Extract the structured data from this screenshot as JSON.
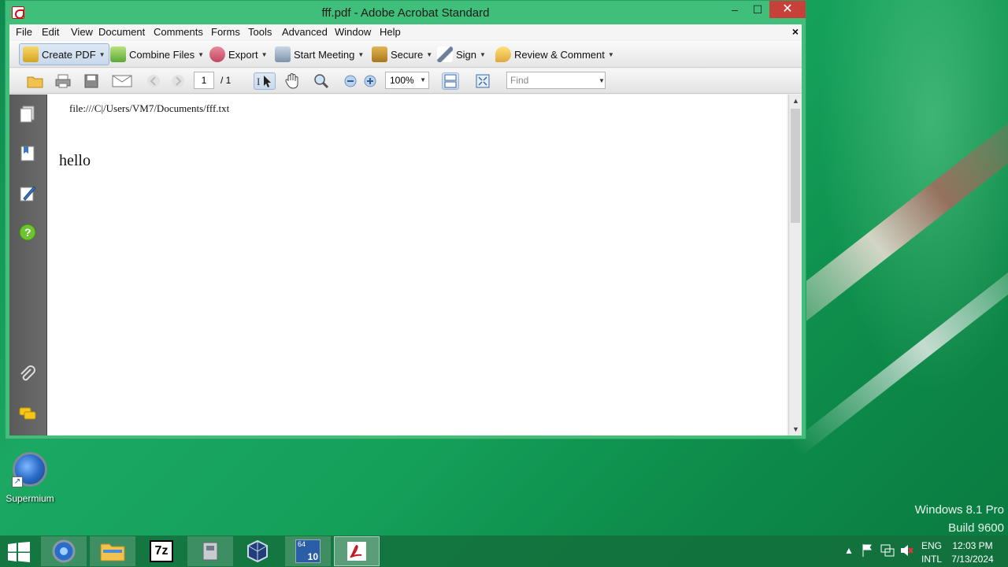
{
  "window": {
    "title": "fff.pdf - Adobe Acrobat Standard",
    "minimize_glyph": "‒",
    "maximize_glyph": "☐",
    "close_glyph": "✕"
  },
  "menubar": {
    "items": [
      "File",
      "Edit",
      "View",
      "Document",
      "Comments",
      "Forms",
      "Tools",
      "Advanced",
      "Window",
      "Help"
    ],
    "close_glyph": "×"
  },
  "toolbar1": {
    "create_pdf": "Create PDF",
    "combine_files": "Combine Files",
    "export": "Export",
    "start_meeting": "Start Meeting",
    "secure": "Secure",
    "sign": "Sign",
    "review_comment": "Review & Comment"
  },
  "toolbar2": {
    "page_current": "1",
    "page_total": "/ 1",
    "zoom": "100%",
    "find_placeholder": "Find"
  },
  "document": {
    "path_text": "file:///C|/Users/VM7/Documents/fff.txt",
    "body_text": "hello"
  },
  "desktop": {
    "icon_label": "Supermium",
    "watermark_line1": "Windows 8.1 Pro",
    "watermark_line2": "Build 9600"
  },
  "taskbar": {
    "lang_line1": "ENG",
    "lang_line2": "INTL",
    "time": "12:03 PM",
    "date": "7/13/2024",
    "sevenzip_label": "7z",
    "badge_64": "64",
    "badge_10": "10"
  },
  "colors": {
    "window_frame": "#3fbf7a",
    "close_button": "#c7403a",
    "accent_blue": "#9cb4d3"
  }
}
